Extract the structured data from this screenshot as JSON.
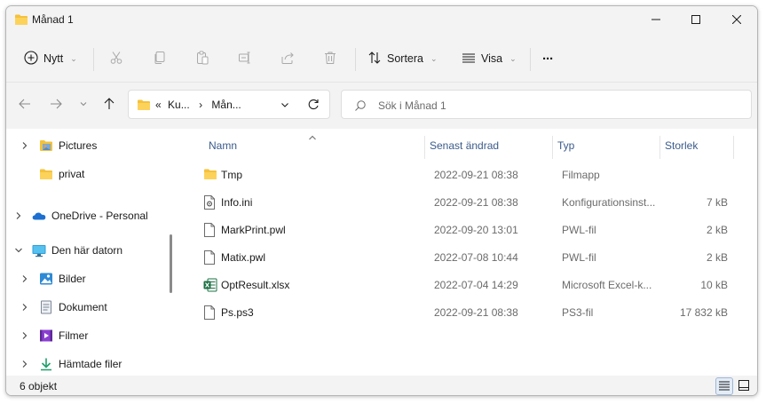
{
  "window": {
    "title": "Månad 1"
  },
  "toolbar": {
    "new_label": "Nytt",
    "sort_label": "Sortera",
    "view_label": "Visa",
    "more_label": "···"
  },
  "address": {
    "overflow": "«",
    "crumbs": [
      "Ku...",
      "Mån..."
    ],
    "separator": "›"
  },
  "search": {
    "placeholder": "Sök i Månad 1"
  },
  "sidebar": {
    "items": [
      {
        "label": "Pictures",
        "icon": "pictures-icon",
        "expandable": true
      },
      {
        "label": "privat",
        "icon": "folder-icon",
        "expandable": false
      },
      {
        "label": "OneDrive - Personal",
        "icon": "onedrive-icon",
        "expandable": true
      },
      {
        "label": "Den här datorn",
        "icon": "computer-icon",
        "expandable": true,
        "expanded": true
      },
      {
        "label": "Bilder",
        "icon": "pictures-icon",
        "expandable": true
      },
      {
        "label": "Dokument",
        "icon": "document-icon",
        "expandable": true
      },
      {
        "label": "Filmer",
        "icon": "video-icon",
        "expandable": true
      },
      {
        "label": "Hämtade filer",
        "icon": "download-icon",
        "expandable": true
      }
    ]
  },
  "columns": {
    "name": "Namn",
    "modified": "Senast ändrad",
    "type": "Typ",
    "size": "Storlek"
  },
  "files": [
    {
      "name": "Tmp",
      "modified": "2022-09-21 08:38",
      "type": "Filmapp",
      "size": "",
      "icon": "folder-icon"
    },
    {
      "name": "Info.ini",
      "modified": "2022-09-21 08:38",
      "type": "Konfigurationsinst...",
      "size": "7 kB",
      "icon": "settings-file-icon"
    },
    {
      "name": "MarkPrint.pwl",
      "modified": "2022-09-20 13:01",
      "type": "PWL-fil",
      "size": "2 kB",
      "icon": "file-icon"
    },
    {
      "name": "Matix.pwl",
      "modified": "2022-07-08 10:44",
      "type": "PWL-fil",
      "size": "2 kB",
      "icon": "file-icon"
    },
    {
      "name": "OptResult.xlsx",
      "modified": "2022-07-04 14:29",
      "type": "Microsoft Excel-k...",
      "size": "10 kB",
      "icon": "excel-file-icon"
    },
    {
      "name": "Ps.ps3",
      "modified": "2022-09-21 08:38",
      "type": "PS3-fil",
      "size": "17 832 kB",
      "icon": "file-icon"
    }
  ],
  "status": {
    "count": "6 objekt"
  },
  "colors": {
    "folder": "#f4c23a",
    "accent": "#005fb8",
    "header_text": "#3b5b8b"
  }
}
